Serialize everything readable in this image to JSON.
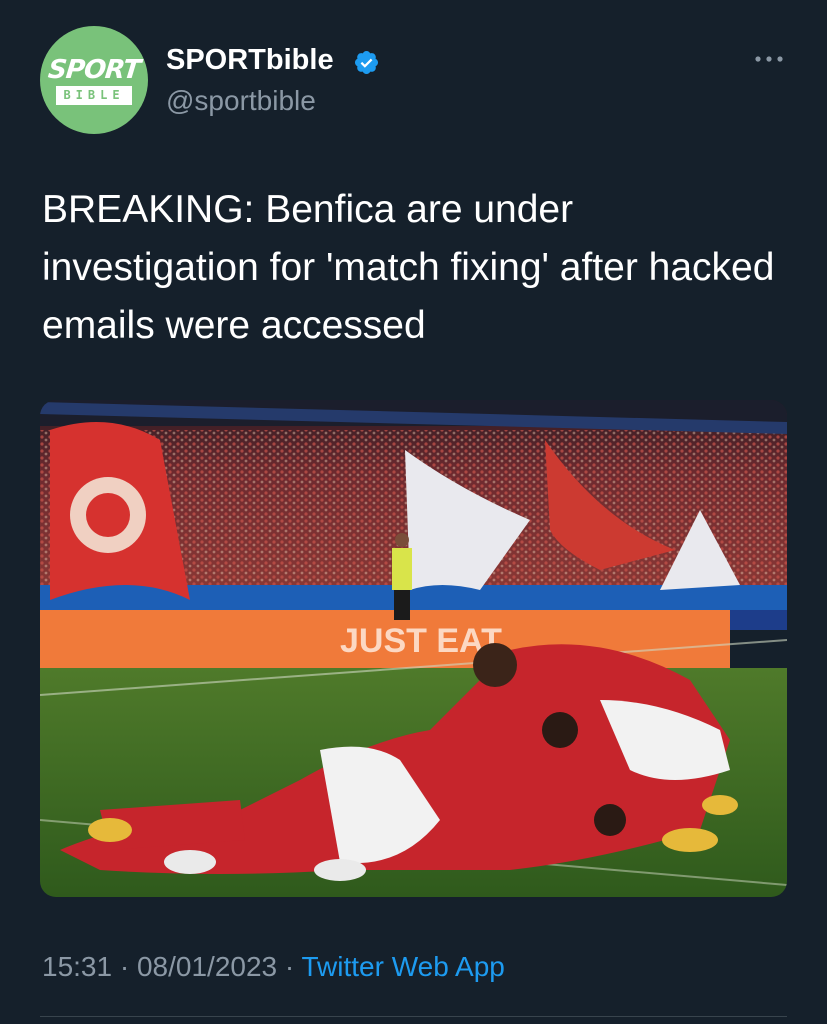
{
  "account": {
    "avatar_word": "SPORT",
    "avatar_sub": "BIBLE",
    "display_name": "SPORTbible",
    "handle": "@sportbible",
    "verified": true,
    "verified_icon": "verified-badge-icon",
    "more_icon": "more-options-icon"
  },
  "tweet": {
    "text": "BREAKING: Benfica are under investigation for 'match fixing' after hacked emails were accessed",
    "media": {
      "subject": "photo",
      "advertising_text": "JUST EAT"
    },
    "time": "15:31",
    "separator": "·",
    "date": "08/01/2023",
    "source": "Twitter Web App"
  },
  "colors": {
    "background": "#15202b",
    "text_primary": "#ffffff",
    "text_secondary": "#8b98a5",
    "link": "#1d9bf0",
    "verified": "#1d9bf0",
    "avatar_bg": "#79c27a"
  }
}
